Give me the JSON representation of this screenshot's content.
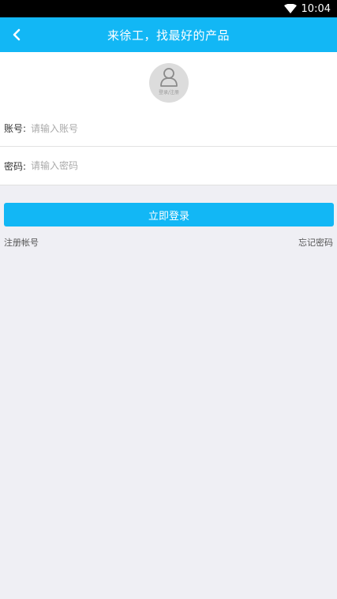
{
  "status_bar": {
    "time": "10:04",
    "wifi_icon": "wifi-icon"
  },
  "app_bar": {
    "title": "来徐工，找最好的产品",
    "back_icon": "back-arrow-icon",
    "color": "#12b7f5"
  },
  "avatar": {
    "label": "登录/注册",
    "icon": "user-icon"
  },
  "form": {
    "account_label": "账号:",
    "account_placeholder": "请输入账号",
    "account_value": "",
    "password_label": "密码:",
    "password_placeholder": "请输入密码",
    "password_value": ""
  },
  "actions": {
    "login_label": "立即登录",
    "register_label": "注册帐号",
    "forgot_label": "忘记密码"
  }
}
